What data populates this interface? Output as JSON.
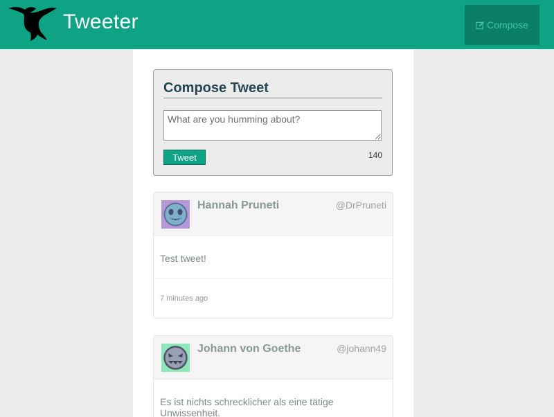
{
  "navbar": {
    "brand": "Tweeter",
    "compose_label": "Compose",
    "background": "#0ea384"
  },
  "compose": {
    "title": "Compose Tweet",
    "placeholder": "What are you humming about?",
    "button_label": "Tweet",
    "counter": "140"
  },
  "tweets": [
    {
      "name": "Hannah Pruneti",
      "handle": "@DrPruneti",
      "text": "Test tweet!",
      "timestamp": "7 minutes ago"
    },
    {
      "name": "Johann von Goethe",
      "handle": "@johann49",
      "text": "Es ist nichts schrecklicher als eine tätige Unwissenheit."
    }
  ]
}
